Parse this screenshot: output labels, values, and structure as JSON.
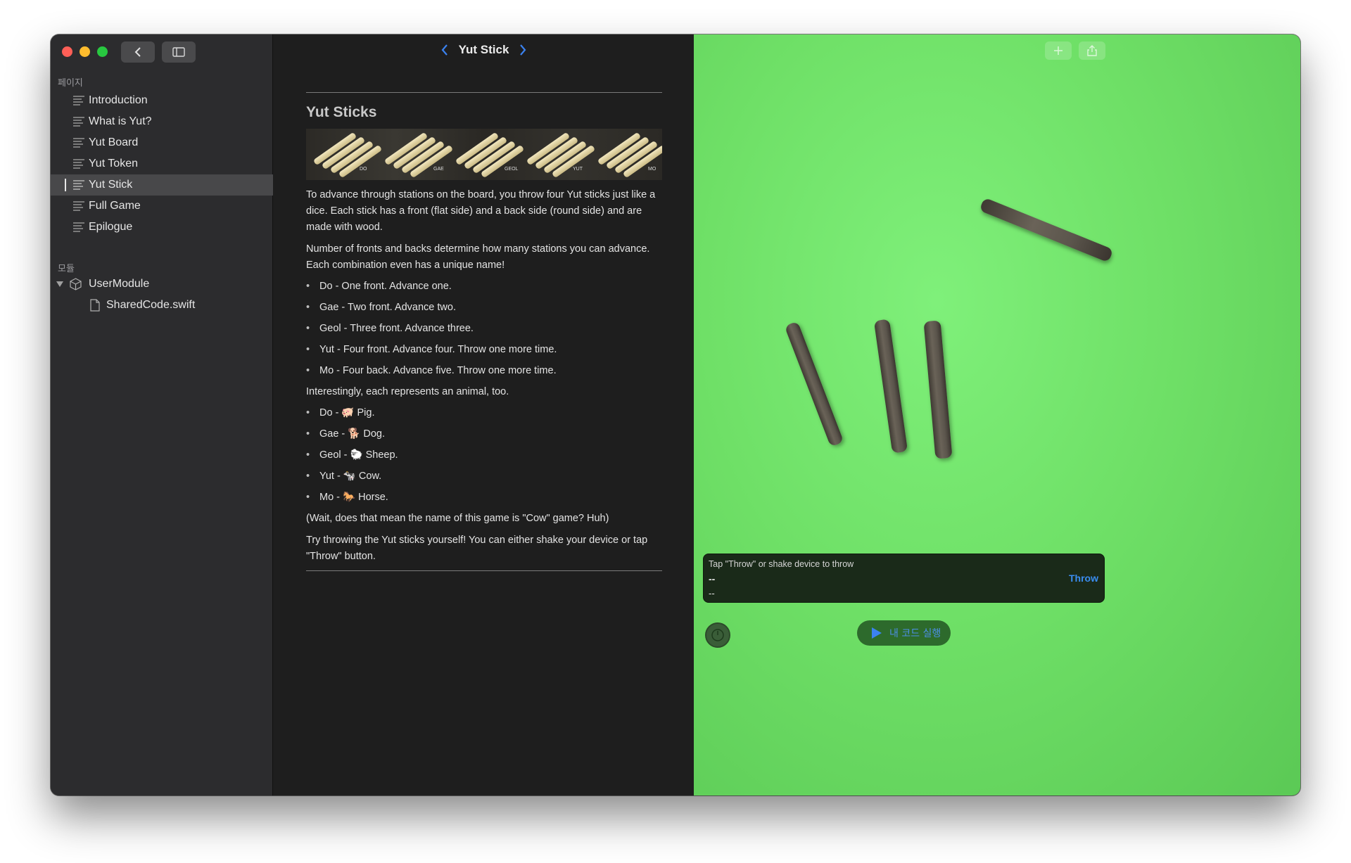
{
  "window": {
    "title": "Yut Stick"
  },
  "sidebar": {
    "pages_title": "페이지",
    "pages": [
      {
        "label": "Introduction"
      },
      {
        "label": "What is Yut?"
      },
      {
        "label": "Yut Board"
      },
      {
        "label": "Yut Token"
      },
      {
        "label": "Yut Stick",
        "selected": true
      },
      {
        "label": "Full Game"
      },
      {
        "label": "Epilogue"
      }
    ],
    "modules_title": "모듈",
    "module": {
      "label": "UserModule",
      "file": "SharedCode.swift"
    }
  },
  "content": {
    "heading": "Yut Sticks",
    "image_labels": [
      "DO",
      "GAE",
      "GEOL",
      "YUT",
      "MO"
    ],
    "p1": "To advance through stations on the board, you throw four Yut sticks just like a dice. Each stick has a front (flat side) and a back side (round side) and are made with wood.",
    "p2": "Number of fronts and backs determine how many stations you can advance. Each combination even has a unique name!",
    "list1": [
      "Do - One front. Advance one.",
      "Gae - Two front. Advance two.",
      "Geol - Three front. Advance three.",
      "Yut - Four front. Advance four. Throw one more time.",
      "Mo - Four back. Advance five. Throw one more time."
    ],
    "p3": "Interestingly, each represents an animal, too.",
    "list2": [
      "Do - 🐖 Pig.",
      "Gae - 🐕 Dog.",
      "Geol - 🐑 Sheep.",
      "Yut - 🐄 Cow.",
      "Mo - 🐎 Horse."
    ],
    "p4": "(Wait, does that mean the name of this game is \"Cow\" game? Huh)",
    "p5": "Try throwing the Yut sticks yourself! You can either shake your device or tap \"Throw\" button."
  },
  "live_view": {
    "status_title": "Tap \"Throw\" or shake device to throw",
    "line1": "--",
    "line2": "--",
    "throw_label": "Throw",
    "run_label": "내 코드 실행",
    "bg_color": "#6fe067"
  }
}
